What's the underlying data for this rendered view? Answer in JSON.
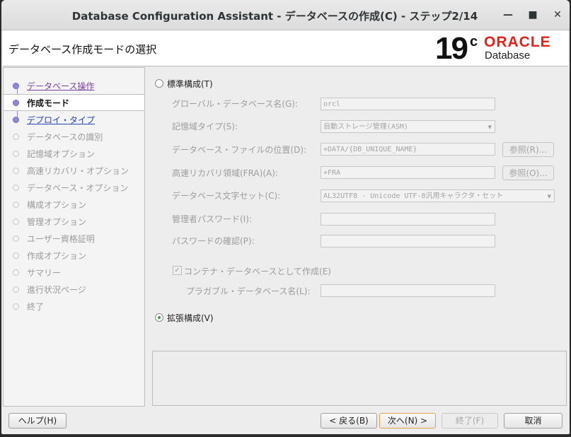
{
  "window": {
    "title": "Database Configuration Assistant - データベースの作成(C) - ステップ2/14",
    "minimize": "—",
    "maximize": "■",
    "close": "✕"
  },
  "header": {
    "heading": "データベース作成モードの選択",
    "logo_version": "19",
    "logo_version_sup": "c",
    "logo_brand": "ORACLE",
    "logo_product": "Database"
  },
  "sidebar": {
    "steps": [
      {
        "label": "データベース操作",
        "state": "done"
      },
      {
        "label": "作成モード",
        "state": "active"
      },
      {
        "label": "デプロイ・タイプ",
        "state": "link"
      },
      {
        "label": "データベースの識別",
        "state": "disabled"
      },
      {
        "label": "記憶域オプション",
        "state": "disabled"
      },
      {
        "label": "高速リカバリ・オプション",
        "state": "disabled"
      },
      {
        "label": "データベース・オプション",
        "state": "disabled"
      },
      {
        "label": "構成オプション",
        "state": "disabled"
      },
      {
        "label": "管理オプション",
        "state": "disabled"
      },
      {
        "label": "ユーザー資格証明",
        "state": "disabled"
      },
      {
        "label": "作成オプション",
        "state": "disabled"
      },
      {
        "label": "サマリー",
        "state": "disabled"
      },
      {
        "label": "進行状況ページ",
        "state": "disabled"
      },
      {
        "label": "終了",
        "state": "disabled"
      }
    ]
  },
  "main": {
    "typical": {
      "label": "標準構成(T)",
      "selected": false,
      "global_db_name_label": "グローバル・データベース名(G):",
      "global_db_name_value": "orcl",
      "storage_type_label": "記憶域タイプ(S):",
      "storage_type_value": "自動ストレージ管理(ASM)",
      "db_file_location_label": "データベース・ファイルの位置(D):",
      "db_file_location_value": "+DATA/{DB_UNIQUE_NAME}",
      "db_file_browse": "参照(R)...",
      "fra_label": "高速リカバリ領域(FRA)(A):",
      "fra_value": "+FRA",
      "fra_browse": "参照(O)...",
      "charset_label": "データベース文字セット(C):",
      "charset_value": "AL32UTF8 - Unicode UTF-8汎用キャラクタ・セット",
      "admin_password_label": "管理者パスワード(I):",
      "admin_password_value": "",
      "confirm_password_label": "パスワードの確認(P):",
      "confirm_password_value": "",
      "container_db_label": "コンテナ・データベースとして作成(E)",
      "container_db_checked": true,
      "pdb_name_label": "プラガブル・データベース名(L):",
      "pdb_name_value": ""
    },
    "advanced": {
      "label": "拡張構成(V)",
      "selected": true
    },
    "message_area": ""
  },
  "footer": {
    "help": "ヘルプ(H)",
    "back": "< 戻る(B)",
    "next": "次へ(N) >",
    "finish": "終了(F)",
    "cancel": "取消"
  },
  "colors": {
    "oracle_red": "#e2231a",
    "completed_step": "#7b3fa0",
    "link_step": "#2343b6",
    "radio_selected": "#3a9a3a"
  }
}
